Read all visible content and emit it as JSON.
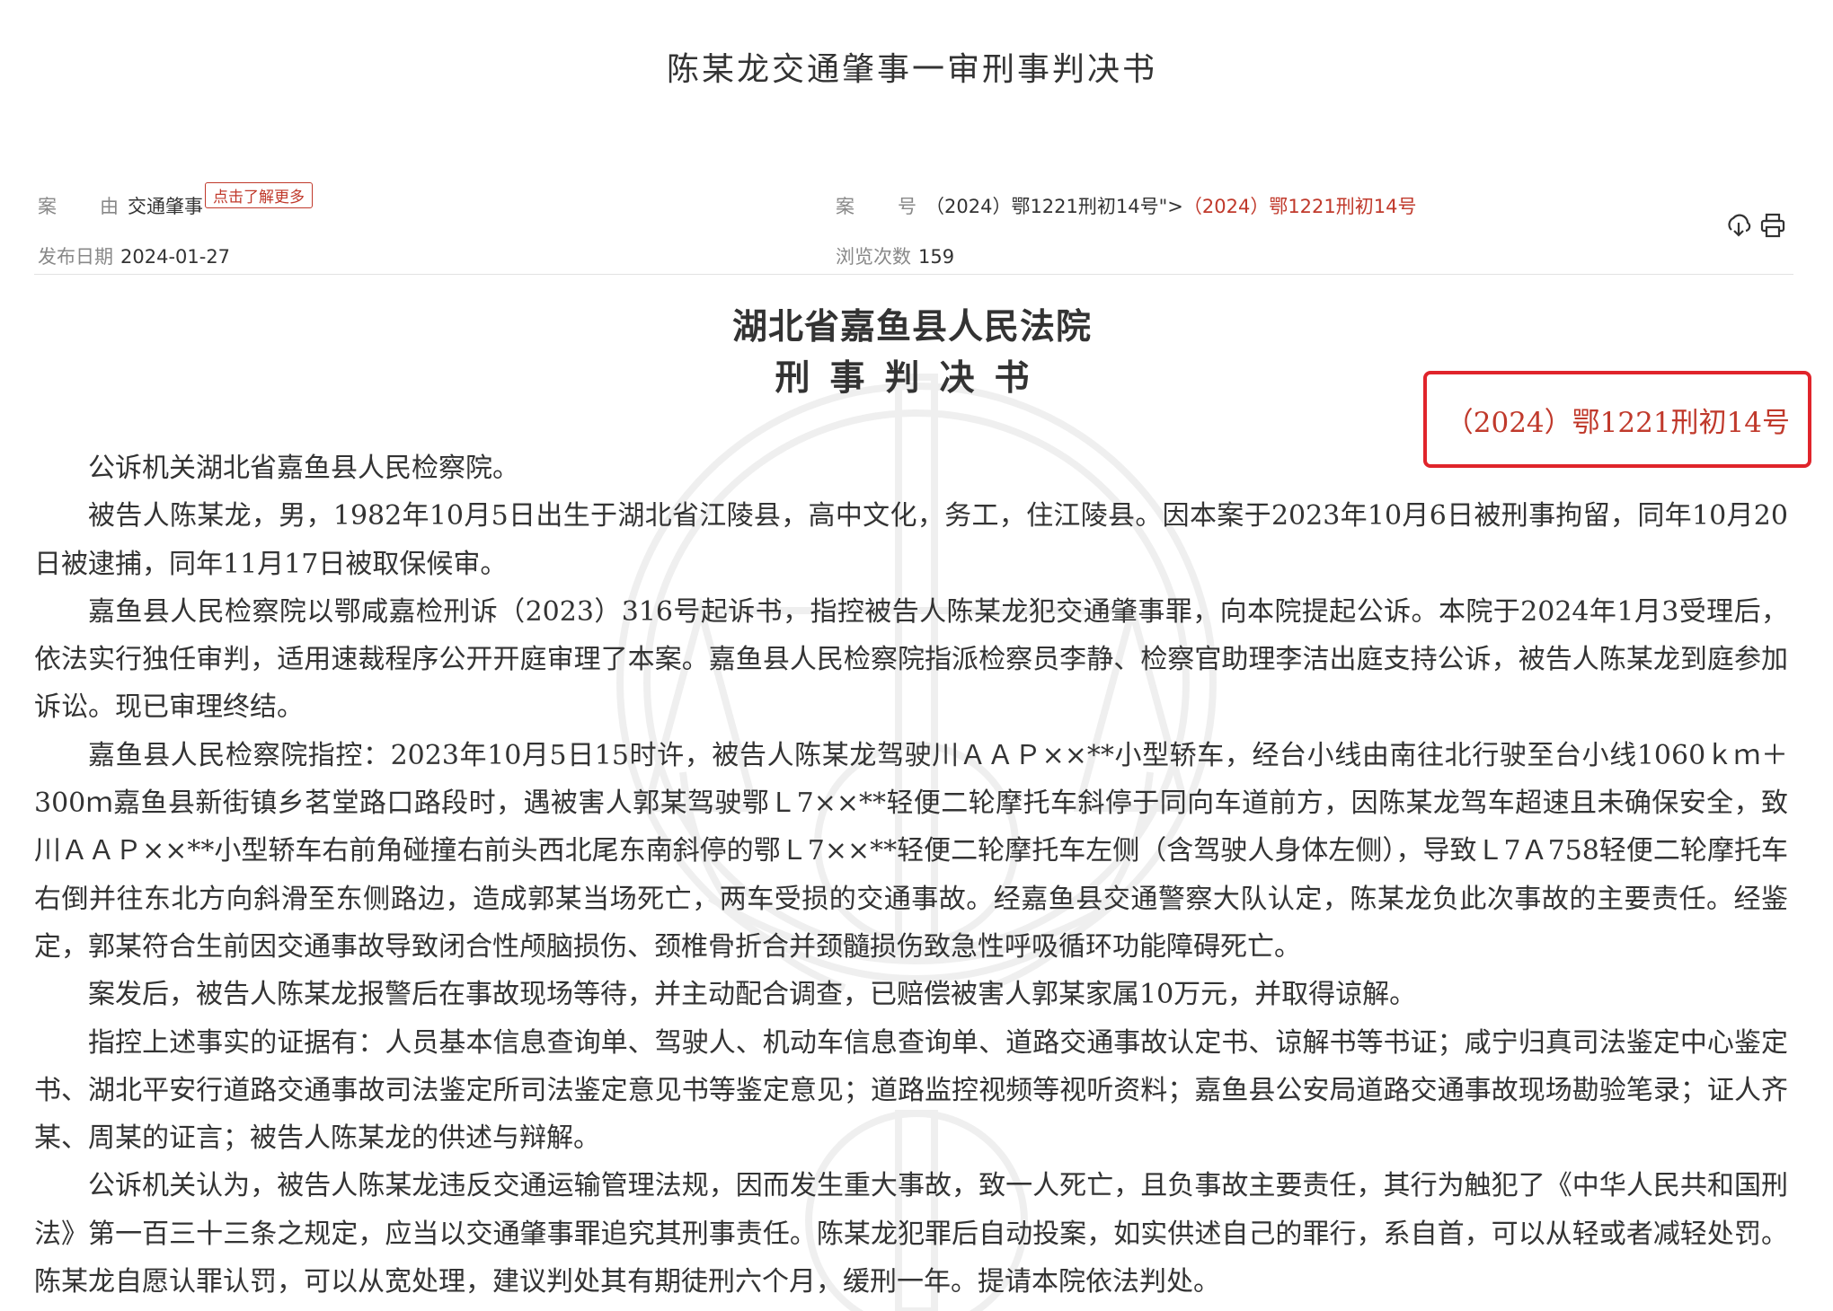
{
  "page": {
    "title": "陈某龙交通肇事一审刑事判决书"
  },
  "meta": {
    "cause_label_1": "案",
    "cause_label_2": "由",
    "cause_value": "交通肇事",
    "learn_more": "点击了解更多",
    "case_label_1": "案",
    "case_label_2": "号",
    "case_value_raw": "（2024）鄂1221刑初14号\">",
    "case_value_red": "（2024）鄂1221刑初14号",
    "date_label": "发布日期",
    "date_value": "2024-01-27",
    "views_label": "浏览次数",
    "views_value": "159"
  },
  "tools": {
    "download_icon": "download-icon",
    "print_icon": "print-icon"
  },
  "document": {
    "court": "湖北省嘉鱼县人民法院",
    "type": "刑事判决书",
    "case_number": "（2024）鄂1221刑初14号",
    "paragraphs": [
      "公诉机关湖北省嘉鱼县人民检察院。",
      "被告人陈某龙，男，1982年10月5日出生于湖北省江陵县，高中文化，务工，住江陵县。因本案于2023年10月6日被刑事拘留，同年10月20日被逮捕，同年11月17日被取保候审。",
      "嘉鱼县人民检察院以鄂咸嘉检刑诉（2023）316号起诉书，指控被告人陈某龙犯交通肇事罪，向本院提起公诉。本院于2024年1月3受理后，依法实行独任审判，适用速裁程序公开开庭审理了本案。嘉鱼县人民检察院指派检察员李静、检察官助理李洁出庭支持公诉，被告人陈某龙到庭参加诉讼。现已审理终结。",
      "嘉鱼县人民检察院指控：2023年10月5日15时许，被告人陈某龙驾驶川ＡＡＰ××**小型轿车，经台小线由南往北行驶至台小线1060ｋｍ＋300ｍ嘉鱼县新街镇乡茗堂路口路段时，遇被害人郭某驾驶鄂Ｌ7××**轻便二轮摩托车斜停于同向车道前方，因陈某龙驾车超速且未确保安全，致川ＡＡＰ××**小型轿车右前角碰撞右前头西北尾东南斜停的鄂Ｌ7××**轻便二轮摩托车左侧（含驾驶人身体左侧），导致Ｌ7Ａ758轻便二轮摩托车右倒并往东北方向斜滑至东侧路边，造成郭某当场死亡，两车受损的交通事故。经嘉鱼县交通警察大队认定，陈某龙负此次事故的主要责任。经鉴定，郭某符合生前因交通事故导致闭合性颅脑损伤、颈椎骨折合并颈髓损伤致急性呼吸循环功能障碍死亡。",
      "案发后，被告人陈某龙报警后在事故现场等待，并主动配合调查，已赔偿被害人郭某家属10万元，并取得谅解。",
      "指控上述事实的证据有：人员基本信息查询单、驾驶人、机动车信息查询单、道路交通事故认定书、谅解书等书证；咸宁归真司法鉴定中心鉴定书、湖北平安行道路交通事故司法鉴定所司法鉴定意见书等鉴定意见；道路监控视频等视听资料；嘉鱼县公安局道路交通事故现场勘验笔录；证人齐某、周某的证言；被告人陈某龙的供述与辩解。",
      "公诉机关认为，被告人陈某龙违反交通运输管理法规，因而发生重大事故，致一人死亡，且负事故主要责任，其行为触犯了《中华人民共和国刑法》第一百三十三条之规定，应当以交通肇事罪追究其刑事责任。陈某龙犯罪后自动投案，如实供述自己的罪行，系自首，可以从轻或者减轻处罚。陈某龙自愿认罪认罚，可以从宽处理，建议判处其有期徒刑六个月，缓刑一年。提请本院依法判处。"
    ]
  },
  "colors": {
    "accent": "#c0392b",
    "highlight_box": "#e0242b",
    "label_gray": "#888888",
    "text": "#333333"
  }
}
